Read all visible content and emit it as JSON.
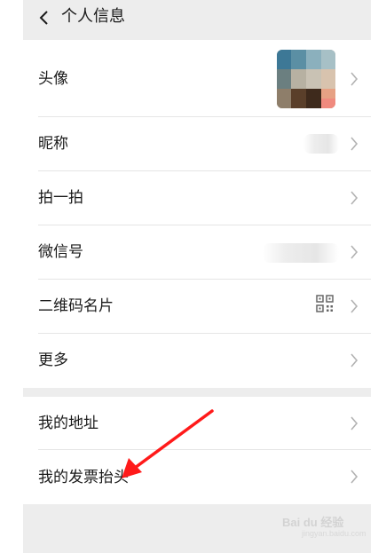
{
  "header": {
    "title": "个人信息",
    "back_icon": "chevron-left-icon"
  },
  "profile_group": {
    "rows": [
      {
        "label": "头像",
        "icon": "chevron-right-icon"
      },
      {
        "label": "昵称",
        "icon": "chevron-right-icon"
      },
      {
        "label": "拍一拍",
        "icon": "chevron-right-icon"
      },
      {
        "label": "微信号",
        "icon": "chevron-right-icon"
      },
      {
        "label": "二维码名片",
        "icon": "chevron-right-icon",
        "extra_icon": "qr-code-icon"
      },
      {
        "label": "更多",
        "icon": "chevron-right-icon"
      }
    ]
  },
  "address_group": {
    "rows": [
      {
        "label": "我的地址",
        "icon": "chevron-right-icon"
      },
      {
        "label": "我的发票抬头",
        "icon": "chevron-right-icon"
      }
    ]
  },
  "colors": {
    "background": "#ededed",
    "card": "#ffffff",
    "text": "#1a1a1a",
    "chevron": "#b2b2b2",
    "annotation_arrow": "#ff1a1a"
  },
  "watermark": {
    "brand": "Bai du 经验",
    "url": "jingyan.baidu.com"
  }
}
